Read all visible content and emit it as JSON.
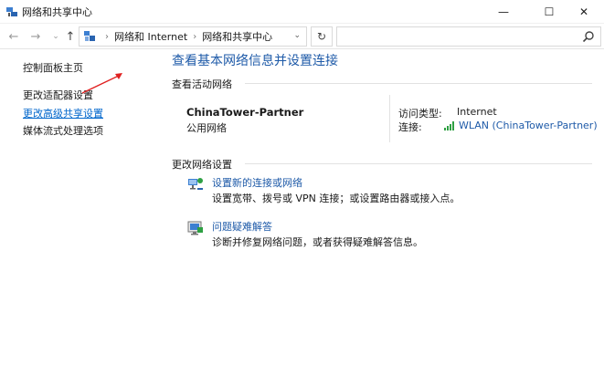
{
  "window": {
    "title": "网络和共享中心",
    "controls": {
      "minimize": "—",
      "maximize": "☐",
      "close": "✕"
    }
  },
  "navigation": {
    "breadcrumb": [
      "网络和 Internet",
      "网络和共享中心"
    ],
    "search": {
      "value": "",
      "placeholder": ""
    }
  },
  "sidebar": {
    "items": [
      {
        "label": "控制面板主页"
      },
      {
        "label": "更改适配器设置"
      },
      {
        "label": "更改高级共享设置"
      },
      {
        "label": "媒体流式处理选项"
      }
    ],
    "annotation_color": "#e02020"
  },
  "main": {
    "heading": "查看基本网络信息并设置连接",
    "active_networks_label": "查看活动网络",
    "network": {
      "name": "ChinaTower-Partner",
      "type": "公用网络",
      "access_type_label": "访问类型:",
      "access_type_value": "Internet",
      "connections_label": "连接:",
      "connection_value": "WLAN (ChinaTower-Partner)"
    },
    "change_settings_label": "更改网络设置",
    "tasks": [
      {
        "link": "设置新的连接或网络",
        "description": "设置宽带、拨号或 VPN 连接；或设置路由器或接入点。",
        "icon": "network-setup-icon"
      },
      {
        "link": "问题疑难解答",
        "description": "诊断并修复网络问题，或者获得疑难解答信息。",
        "icon": "troubleshoot-icon"
      }
    ]
  },
  "colors": {
    "link": "#1e5aa8",
    "heading": "#1e5aa8",
    "wifi": "#2ea043"
  }
}
